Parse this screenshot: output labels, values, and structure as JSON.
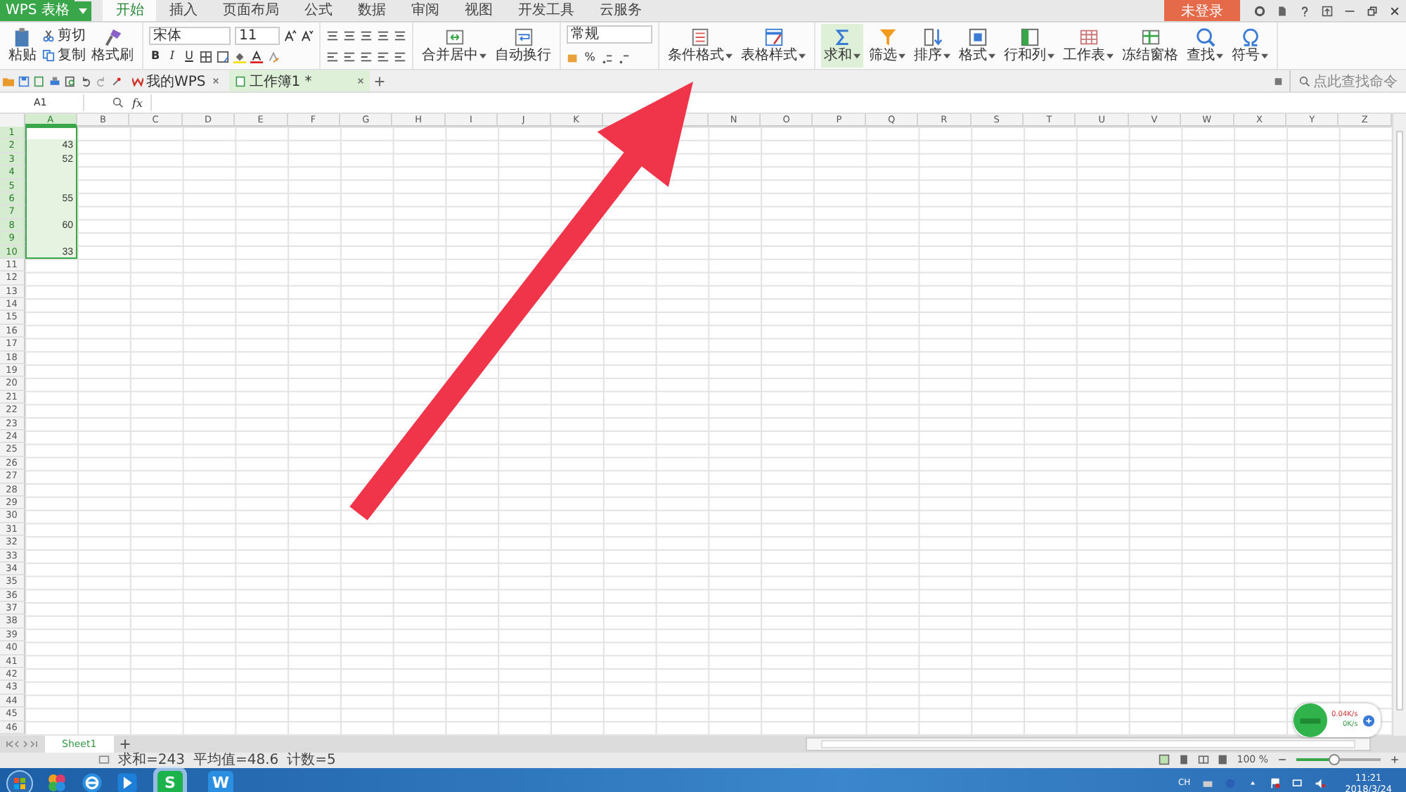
{
  "app": {
    "name": "WPS 表格"
  },
  "menu_tabs": [
    {
      "label": "开始",
      "selected": true
    },
    {
      "label": "插入",
      "selected": false
    },
    {
      "label": "页面布局",
      "selected": false
    },
    {
      "label": "公式",
      "selected": false
    },
    {
      "label": "数据",
      "selected": false
    },
    {
      "label": "审阅",
      "selected": false
    },
    {
      "label": "视图",
      "selected": false
    },
    {
      "label": "开发工具",
      "selected": false
    },
    {
      "label": "云服务",
      "selected": false
    }
  ],
  "login": "未登录",
  "ribbon": {
    "clipboard": {
      "paste": "粘贴",
      "cut": "剪切",
      "copy": "复制",
      "format_painter": "格式刷"
    },
    "font": {
      "name": "宋体",
      "size": "11",
      "bold": "B",
      "italic": "I",
      "underline": "U"
    },
    "number_format": {
      "value": "常规",
      "percent": "%"
    },
    "merge_tools": [
      {
        "label": "合并居中",
        "dropdown": true
      },
      {
        "label": "自动换行",
        "dropdown": false
      }
    ],
    "style_tools": [
      {
        "label": "条件格式",
        "dropdown": true
      },
      {
        "label": "表格样式",
        "dropdown": true
      }
    ],
    "edit_tools": [
      {
        "label": "求和",
        "dropdown": true,
        "selected": true
      },
      {
        "label": "筛选",
        "dropdown": true,
        "selected": false
      },
      {
        "label": "排序",
        "dropdown": true,
        "selected": false
      },
      {
        "label": "格式",
        "dropdown": true,
        "selected": false
      },
      {
        "label": "行和列",
        "dropdown": true,
        "selected": false
      },
      {
        "label": "工作表",
        "dropdown": true,
        "selected": false
      },
      {
        "label": "冻结窗格",
        "dropdown": false,
        "selected": false
      },
      {
        "label": "查找",
        "dropdown": true,
        "selected": false
      },
      {
        "label": "符号",
        "dropdown": true,
        "selected": false
      }
    ]
  },
  "doc_tabs": [
    {
      "label": "我的WPS",
      "selected": false
    },
    {
      "label": "工作簿1 *",
      "selected": true
    }
  ],
  "command_search": {
    "placeholder": "点此查找命令"
  },
  "name_box": "A1",
  "fx": "fx",
  "columns": [
    {
      "label": "A",
      "selected": true
    },
    {
      "label": "B",
      "selected": false
    },
    {
      "label": "C",
      "selected": false
    },
    {
      "label": "D",
      "selected": false
    },
    {
      "label": "E",
      "selected": false
    },
    {
      "label": "F",
      "selected": false
    },
    {
      "label": "G",
      "selected": false
    },
    {
      "label": "H",
      "selected": false
    },
    {
      "label": "I",
      "selected": false
    },
    {
      "label": "J",
      "selected": false
    },
    {
      "label": "K",
      "selected": false
    },
    {
      "selected": false
    },
    {
      "selected": false
    },
    {
      "label": "N",
      "selected": false
    },
    {
      "label": "O",
      "selected": false
    },
    {
      "label": "P",
      "selected": false
    },
    {
      "label": "Q",
      "selected": false
    },
    {
      "label": "R",
      "selected": false
    },
    {
      "label": "S",
      "selected": false
    },
    {
      "label": "T",
      "selected": false
    },
    {
      "label": "U",
      "selected": false
    },
    {
      "label": "V",
      "selected": false
    },
    {
      "label": "W",
      "selected": false
    },
    {
      "label": "X",
      "selected": false
    },
    {
      "label": "Y",
      "selected": false
    },
    {
      "label": "Z",
      "selected": false
    }
  ],
  "rows": [
    {
      "label": "1",
      "selected": true
    },
    {
      "label": "2",
      "selected": true,
      "cells": [
        "43"
      ]
    },
    {
      "label": "3",
      "selected": true,
      "cells": [
        "52"
      ]
    },
    {
      "label": "4",
      "selected": true
    },
    {
      "label": "5",
      "selected": true
    },
    {
      "label": "6",
      "selected": true,
      "cells": [
        "55"
      ]
    },
    {
      "label": "7",
      "selected": true
    },
    {
      "label": "8",
      "selected": true,
      "cells": [
        "60"
      ]
    },
    {
      "label": "9",
      "selected": true
    },
    {
      "label": "10",
      "selected": true,
      "cells": [
        "33"
      ]
    },
    {
      "label": "11",
      "selected": false
    },
    {
      "label": "12",
      "selected": false
    },
    {
      "label": "13",
      "selected": false
    },
    {
      "label": "14",
      "selected": false
    },
    {
      "label": "15",
      "selected": false
    },
    {
      "label": "16",
      "selected": false
    },
    {
      "label": "17",
      "selected": false
    },
    {
      "label": "18",
      "selected": false
    },
    {
      "label": "19",
      "selected": false
    },
    {
      "label": "20",
      "selected": false
    },
    {
      "label": "21",
      "selected": false
    },
    {
      "label": "22",
      "selected": false
    },
    {
      "label": "23",
      "selected": false
    },
    {
      "label": "24",
      "selected": false
    },
    {
      "label": "25",
      "selected": false
    },
    {
      "label": "26",
      "selected": false
    },
    {
      "label": "27",
      "selected": false
    },
    {
      "label": "28",
      "selected": false
    },
    {
      "label": "29",
      "selected": false
    },
    {
      "label": "30",
      "selected": false
    },
    {
      "label": "31",
      "selected": false
    },
    {
      "label": "32",
      "selected": false
    },
    {
      "label": "33",
      "selected": false
    },
    {
      "label": "34",
      "selected": false
    },
    {
      "label": "35",
      "selected": false
    },
    {
      "label": "36",
      "selected": false
    },
    {
      "label": "37",
      "selected": false
    },
    {
      "label": "38",
      "selected": false
    },
    {
      "label": "39",
      "selected": false
    },
    {
      "label": "40",
      "selected": false
    },
    {
      "label": "41",
      "selected": false
    },
    {
      "label": "42",
      "selected": false
    },
    {
      "label": "43",
      "selected": false
    },
    {
      "label": "44",
      "selected": false
    },
    {
      "label": "45",
      "selected": false
    },
    {
      "label": "46",
      "selected": false
    }
  ],
  "sheet_tabs": [
    {
      "label": "Sheet1",
      "selected": true
    }
  ],
  "status": [
    "求和=243",
    "平均值=48.6",
    "计数=5"
  ],
  "zoom": {
    "reading": "100 %",
    "level": 0.45
  },
  "net_widget": {
    "up": "0.04K/s",
    "down": "0K/s"
  },
  "taskbar": {
    "apps": [
      {
        "glyph": "S",
        "selected": true,
        "color": "#1db34c"
      },
      {
        "glyph": "W",
        "selected": false,
        "color": "#2a8fe0"
      }
    ],
    "lang": "CH",
    "time": "11:21",
    "date": "2018/3/24"
  }
}
